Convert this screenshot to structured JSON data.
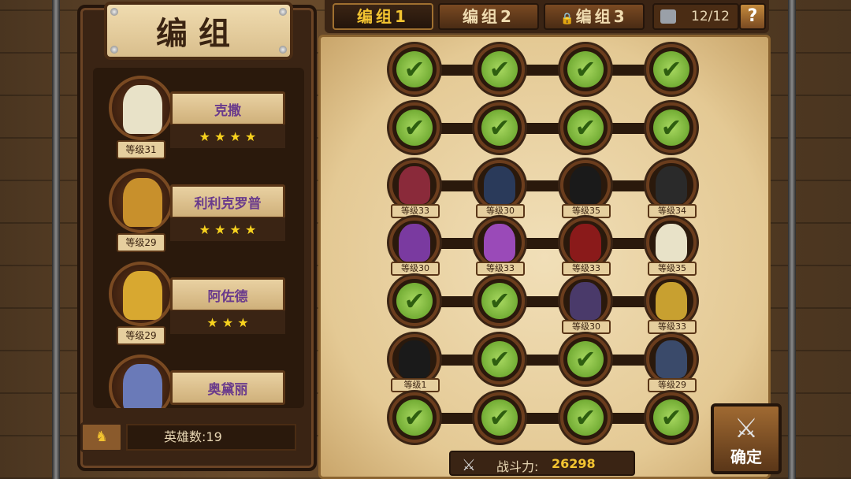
{
  "title": "编组",
  "heroes": [
    {
      "name": "克撒",
      "level_label": "等级31",
      "stars": "★ ★ ★ ★",
      "color": "#e8e2c8"
    },
    {
      "name": "利利克罗普",
      "level_label": "等级29",
      "stars": "★ ★ ★ ★",
      "color": "#c8902c"
    },
    {
      "name": "阿佐德",
      "level_label": "等级29",
      "stars": "★ ★ ★",
      "color": "#d8a830"
    },
    {
      "name": "奥黛丽",
      "level_label": "",
      "stars": "",
      "color": "#6a7ab8"
    }
  ],
  "hero_count": "英雄数:19",
  "tabs": [
    {
      "label": "编组1",
      "active": true,
      "locked": false
    },
    {
      "label": "编组2",
      "active": false,
      "locked": false
    },
    {
      "label": "编组3",
      "active": false,
      "locked": true
    }
  ],
  "capacity": "12/12",
  "help_label": "?",
  "power_label": "战斗力:",
  "power_value": "26298",
  "confirm_label": "确定",
  "check_glyph": "✔",
  "grid": [
    [
      {
        "empty": true
      },
      {
        "empty": true
      },
      {
        "empty": true
      },
      {
        "empty": true
      }
    ],
    [
      {
        "empty": true
      },
      {
        "empty": true
      },
      {
        "empty": true
      },
      {
        "empty": true
      }
    ],
    [
      {
        "level": "等级33",
        "color": "#8a2a3a"
      },
      {
        "level": "等级30",
        "color": "#2a3a5a"
      },
      {
        "level": "等级35",
        "color": "#1a1a1a"
      },
      {
        "level": "等级34",
        "color": "#2a2a2a"
      }
    ],
    [
      {
        "level": "等级30",
        "color": "#7a3aa0"
      },
      {
        "level": "等级33",
        "color": "#9a4ab8"
      },
      {
        "level": "等级33",
        "color": "#8a1a1a"
      },
      {
        "level": "等级35",
        "color": "#e8e2c8"
      }
    ],
    [
      {
        "empty": true
      },
      {
        "empty": true
      },
      {
        "level": "等级30",
        "color": "#4a3a6a"
      },
      {
        "level": "等级33",
        "color": "#c8a030"
      }
    ],
    [
      {
        "level": "等级1",
        "color": "#1a1a1a"
      },
      {
        "empty": true
      },
      {
        "empty": true
      },
      {
        "level": "等级29",
        "color": "#3a4a6a"
      }
    ],
    [
      {
        "empty": true
      },
      {
        "empty": true
      },
      {
        "empty": true
      },
      {
        "empty": true
      }
    ]
  ]
}
